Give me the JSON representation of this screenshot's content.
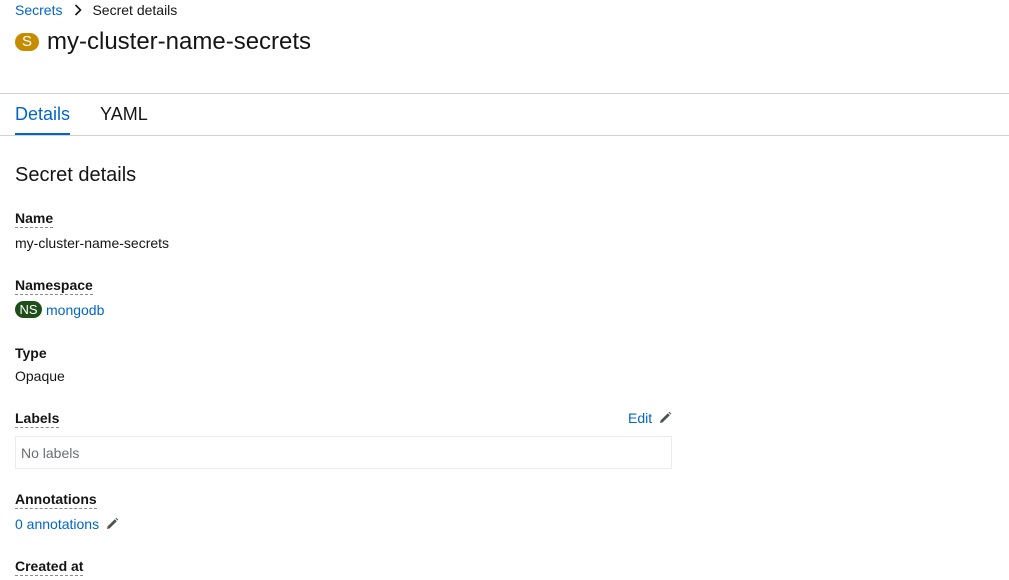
{
  "breadcrumb": {
    "parent": "Secrets",
    "current": "Secret details"
  },
  "header": {
    "badge": "S",
    "badge_color": "#c58c00",
    "title": "my-cluster-name-secrets"
  },
  "tabs": [
    {
      "label": "Details",
      "active": true
    },
    {
      "label": "YAML",
      "active": false
    }
  ],
  "section": {
    "heading": "Secret details"
  },
  "fields": {
    "name_label": "Name",
    "name_value": "my-cluster-name-secrets",
    "namespace_label": "Namespace",
    "namespace_badge": "NS",
    "namespace_badge_color": "#1e4f18",
    "namespace_value": "mongodb",
    "type_label": "Type",
    "type_value": "Opaque",
    "labels_label": "Labels",
    "labels_edit": "Edit",
    "labels_empty": "No labels",
    "annotations_label": "Annotations",
    "annotations_value": "0 annotations",
    "created_label": "Created at"
  },
  "colors": {
    "link": "#0066cc",
    "tab_active": "#0066cc",
    "divider": "#d2d2d2"
  },
  "icons": {
    "breadcrumb_separator": "chevron-right-icon",
    "edit": "pencil-icon"
  }
}
